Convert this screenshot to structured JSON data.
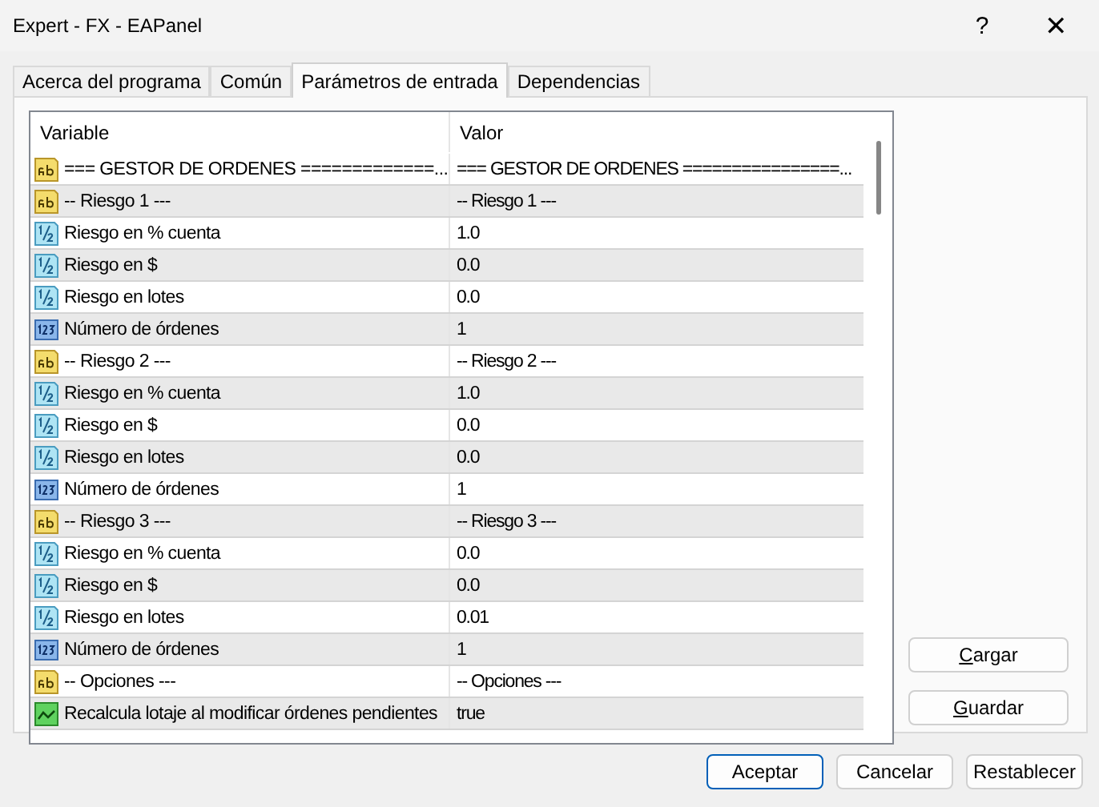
{
  "window": {
    "title": "Expert - FX - EAPanel",
    "help": "?",
    "close": "✕"
  },
  "tabs": [
    {
      "label": "Acerca del programa",
      "selected": false
    },
    {
      "label": "Común",
      "selected": false
    },
    {
      "label": "Parámetros de entrada",
      "selected": true
    },
    {
      "label": "Dependencias",
      "selected": false
    }
  ],
  "table": {
    "columns": [
      "Variable",
      "Valor"
    ],
    "rows": [
      {
        "kind": "string",
        "variable": "=== GESTOR DE ORDENES =============...",
        "value": "=== GESTOR DE ORDENES ================..."
      },
      {
        "kind": "string",
        "variable": "-- Riesgo 1 ---",
        "value": "-- Riesgo 1 ---"
      },
      {
        "kind": "double",
        "variable": "Riesgo en % cuenta",
        "value": "1.0"
      },
      {
        "kind": "double",
        "variable": "Riesgo en $",
        "value": "0.0"
      },
      {
        "kind": "double",
        "variable": "Riesgo en lotes",
        "value": "0.0"
      },
      {
        "kind": "int",
        "variable": "Número de órdenes",
        "value": "1"
      },
      {
        "kind": "string",
        "variable": "-- Riesgo 2 ---",
        "value": "-- Riesgo 2 ---"
      },
      {
        "kind": "double",
        "variable": "Riesgo en % cuenta",
        "value": "1.0"
      },
      {
        "kind": "double",
        "variable": "Riesgo en $",
        "value": "0.0"
      },
      {
        "kind": "double",
        "variable": "Riesgo en lotes",
        "value": "0.0"
      },
      {
        "kind": "int",
        "variable": "Número de órdenes",
        "value": "1"
      },
      {
        "kind": "string",
        "variable": "-- Riesgo 3 ---",
        "value": "-- Riesgo 3 ---"
      },
      {
        "kind": "double",
        "variable": "Riesgo en % cuenta",
        "value": "0.0"
      },
      {
        "kind": "double",
        "variable": "Riesgo en $",
        "value": "0.0"
      },
      {
        "kind": "double",
        "variable": "Riesgo en lotes",
        "value": "0.01"
      },
      {
        "kind": "int",
        "variable": "Número de órdenes",
        "value": "1"
      },
      {
        "kind": "string",
        "variable": "-- Opciones ---",
        "value": "-- Opciones ---"
      },
      {
        "kind": "bool",
        "variable": "Recalcula lotaje al modificar órdenes pendientes",
        "value": "true"
      }
    ]
  },
  "side_buttons": [
    {
      "label": "Cargar",
      "underline_first": true
    },
    {
      "label": "Guardar",
      "underline_first": true
    }
  ],
  "buttons": [
    {
      "label": "Aceptar",
      "default": true
    },
    {
      "label": "Cancelar",
      "default": false
    },
    {
      "label": "Restablecer",
      "default": false
    }
  ]
}
